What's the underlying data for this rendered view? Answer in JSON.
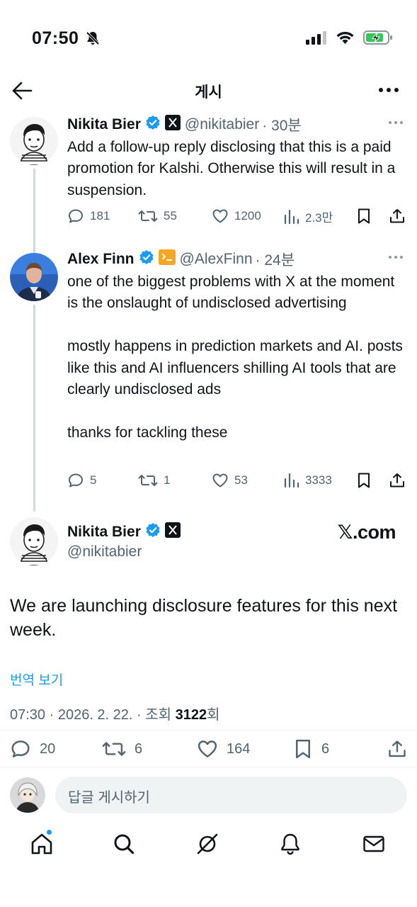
{
  "status_bar": {
    "time": "07:50"
  },
  "header": {
    "title": "게시"
  },
  "tweets": [
    {
      "name": "Nikita Bier",
      "handle": "@nikitabier",
      "time": "· 30분",
      "text": "Add a follow-up reply disclosing that this is a paid promotion for Kalshi. Otherwise this will result in a suspension.",
      "replies": "181",
      "reposts": "55",
      "likes": "1200",
      "views": "2.3만"
    },
    {
      "name": "Alex Finn",
      "handle": "@AlexFinn",
      "time": "· 24분",
      "text": "one of the biggest problems with X at the moment is the onslaught of undisclosed advertising\n\nmostly happens in prediction markets and AI. posts like this and AI influencers shilling AI tools that are clearly undisclosed ads\n\nthanks for tackling these",
      "replies": "5",
      "reposts": "1",
      "likes": "53",
      "views": "3333"
    }
  ],
  "main_post": {
    "name": "Nikita Bier",
    "handle": "@nikitabier",
    "source_badge": "𝕏.com",
    "text": "We are launching disclosure features for this next week.",
    "translate_label": "번역 보기",
    "meta_prefix": "07:30 · 2026. 2. 22. · 조회 ",
    "views": "3122",
    "meta_suffix": "회",
    "replies": "20",
    "reposts": "6",
    "likes": "164",
    "bookmarks": "6"
  },
  "reply_bar": {
    "placeholder": "답글 게시하기"
  },
  "colors": {
    "accent": "#1d9bf0",
    "text": "#0f1419",
    "muted": "#536471",
    "verified": "#1d9bf0",
    "battery": "#34c759"
  }
}
